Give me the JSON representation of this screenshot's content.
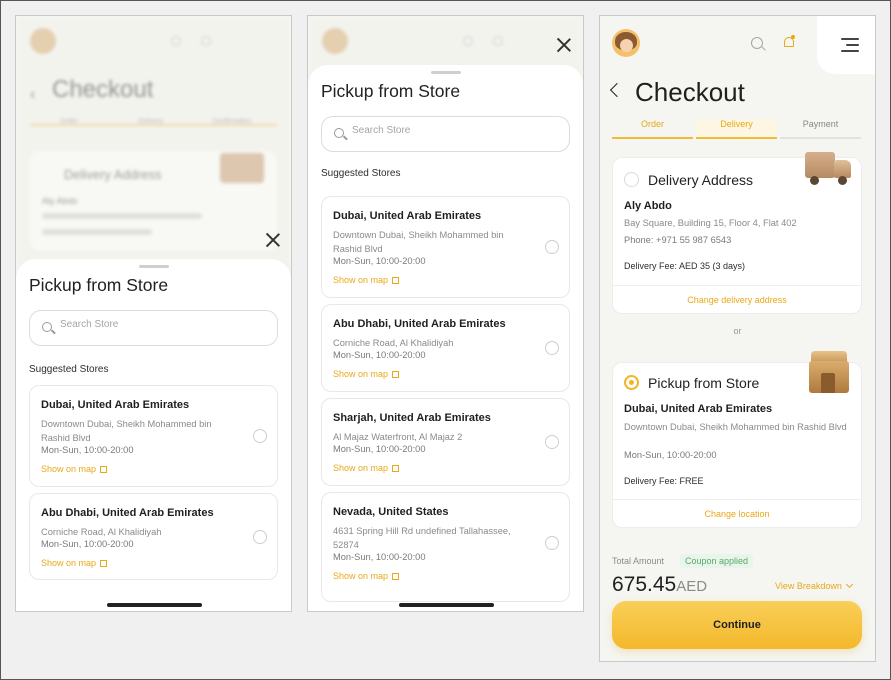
{
  "sheet": {
    "title": "Pickup from Store",
    "search_placeholder": "Search Store",
    "suggested_label": "Suggested Stores",
    "show_on_map": "Show on map"
  },
  "stores": [
    {
      "name": "Dubai, United Arab Emirates",
      "address": "Downtown Dubai, Sheikh Mohammed bin Rashid Blvd",
      "hours": "Mon-Sun, 10:00-20:00"
    },
    {
      "name": "Abu Dhabi, United Arab Emirates",
      "address": "Corniche Road, Al Khalidiyah",
      "hours": "Mon-Sun, 10:00-20:00"
    },
    {
      "name": "Sharjah, United Arab Emirates",
      "address": "Al Majaz Waterfront, Al Majaz 2",
      "hours": "Mon-Sun, 10:00-20:00"
    },
    {
      "name": "Nevada, United States",
      "address": "4631 Spring Hill Rd undefined Tallahassee, 52874",
      "hours": "Mon-Sun, 10:00-20:00"
    }
  ],
  "checkout": {
    "title": "Checkout",
    "steps": [
      "Order",
      "Delivery",
      "Payment"
    ],
    "delivery_option": {
      "title": "Delivery Address",
      "name": "Aly Abdo",
      "address": "Bay Square, Building 15, Floor 4, Flat 402",
      "phone": "Phone: +971 55 987 6543",
      "fee": "Delivery Fee: AED 35 (3 days)",
      "link": "Change delivery address"
    },
    "or_label": "or",
    "pickup_option": {
      "title": "Pickup from Store",
      "name": "Dubai, United Arab Emirates",
      "address": "Downtown Dubai, Sheikh Mohammed bin Rashid Blvd",
      "hours": "Mon-Sun, 10:00-20:00",
      "fee": "Delivery Fee: FREE",
      "link": "Change location"
    },
    "total_label": "Total Amount",
    "coupon": "Coupon applied",
    "amount": "675.45",
    "currency": "AED",
    "breakdown": "View Breakdown",
    "continue_label": "Continue"
  },
  "blurred_backdrop": {
    "title": "Checkout",
    "steps": [
      "Order",
      "Delivery",
      "Confirmation"
    ],
    "delivery_option": "Delivery Address",
    "name": "Aly Abdo"
  },
  "colors": {
    "accent": "#f3b82c",
    "link": "#e8a818",
    "coupon": "#5aa868"
  },
  "icons": [
    "avatar",
    "search-icon",
    "bell-icon",
    "menu-icon",
    "back-chevron-icon",
    "close-icon",
    "external-link-icon",
    "truck-icon",
    "store-icon",
    "chevron-down-icon"
  ]
}
